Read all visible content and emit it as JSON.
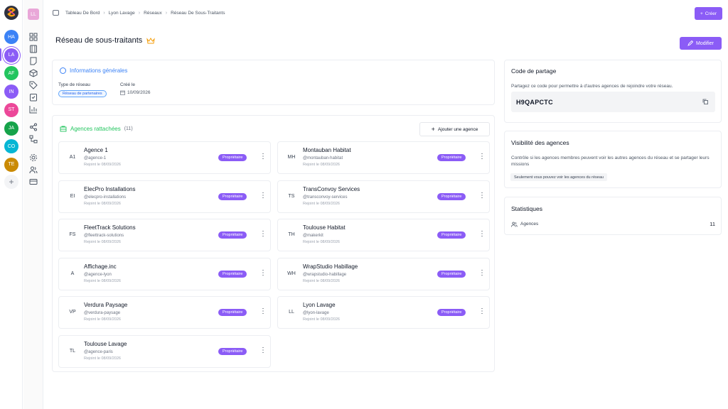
{
  "workspaces": [
    {
      "initials": "HA",
      "color": "#3b82f6"
    },
    {
      "initials": "LA",
      "color": "#8b5cf6",
      "active": true
    },
    {
      "initials": "AF",
      "color": "#22c55e"
    },
    {
      "initials": "IN",
      "color": "#8b5cf6"
    },
    {
      "initials": "ST",
      "color": "#ec4899"
    },
    {
      "initials": "JA",
      "color": "#16a34a"
    },
    {
      "initials": "CO",
      "color": "#06b6d4"
    },
    {
      "initials": "TE",
      "color": "#ca8a04"
    }
  ],
  "nav": {
    "avatar": "LL",
    "icons": [
      "grid-icon",
      "film-icon",
      "note-icon",
      "box-icon",
      "tag-icon",
      "checklist-icon",
      "bar-chart-icon",
      "share-icon",
      "network-icon",
      "settings-icon",
      "users-icon",
      "card-icon"
    ]
  },
  "breadcrumb": [
    "Tableau De Bord",
    "Lyon Lavage",
    "Réseaux",
    "Réseau De Sous-Traitants"
  ],
  "create_label": "Créer",
  "page_title": "Réseau de sous-traitants",
  "edit_label": "Modifier",
  "general": {
    "title": "Informations générales",
    "type_label": "Type de réseau",
    "type_value": "Réseau de partenaires",
    "created_label": "Créé le",
    "created_value": "10/09/2026"
  },
  "agencies_section": {
    "title": "Agences rattachées",
    "count": "(11)",
    "add_label": "Ajouter une agence",
    "badge": "Propriétaire",
    "items": [
      {
        "initials": "A1",
        "name": "Agence 1",
        "handle": "@agence-1",
        "joined": "Rejoint le 08/09/2026"
      },
      {
        "initials": "MH",
        "name": "Montauban Habitat",
        "handle": "@montauban-habitat",
        "joined": "Rejoint le 08/09/2026"
      },
      {
        "initials": "EI",
        "name": "ElecPro Installations",
        "handle": "@elecpro-installations",
        "joined": "Rejoint le 08/09/2026"
      },
      {
        "initials": "TS",
        "name": "TransConvoy Services",
        "handle": "@transconvoy-services",
        "joined": "Rejoint le 08/09/2026"
      },
      {
        "initials": "FS",
        "name": "FleetTrack Solutions",
        "handle": "@fleettrack-solutions",
        "joined": "Rejoint le 08/09/2026"
      },
      {
        "initials": "TH",
        "name": "Toulouse Habitat",
        "handle": "@makerkit",
        "joined": "Rejoint le 08/09/2026"
      },
      {
        "initials": "A",
        "name": "Affichage.inc",
        "handle": "@agence-lyon",
        "joined": "Rejoint le 08/09/2026"
      },
      {
        "initials": "WH",
        "name": "WrapStudio Habillage",
        "handle": "@wrapstudio-habillage",
        "joined": "Rejoint le 08/09/2026"
      },
      {
        "initials": "VP",
        "name": "Verdura Paysage",
        "handle": "@verdura-paysage",
        "joined": "Rejoint le 08/09/2026"
      },
      {
        "initials": "LL",
        "name": "Lyon Lavage",
        "handle": "@lyon-lavage",
        "joined": "Rejoint le 08/09/2026"
      },
      {
        "initials": "TL",
        "name": "Toulouse Lavage",
        "handle": "@agence-paris",
        "joined": "Rejoint le 08/09/2026"
      }
    ]
  },
  "share": {
    "title": "Code de partage",
    "desc": "Partagez ce code pour permettre à d'autres agences de rejoindre votre réseau.",
    "code": "H9QAPCTC"
  },
  "visibility": {
    "title": "Visibilité des agences",
    "desc": "Contrôle si les agences membres peuvent voir les autres agences du réseau et se partager leurs missions",
    "pill": "Seulement vous pouvez voir les agences du réseau"
  },
  "stats": {
    "title": "Statistiques",
    "label": "Agences",
    "value": "11"
  }
}
